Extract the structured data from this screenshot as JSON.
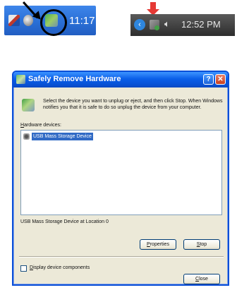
{
  "taskbar_xp": {
    "clock": "11:17"
  },
  "taskbar_win7": {
    "time": "12:52 PM",
    "volume_glyph": "🔈︎"
  },
  "dialog": {
    "title": "Safely Remove Hardware",
    "help_glyph": "?",
    "close_glyph": "✕",
    "instructions": "Select the device you want to unplug or eject, and then click Stop. When Windows notifies you that it is safe to do so unplug the device from your computer.",
    "devices_label_accel": "H",
    "devices_label_rest": "ardware devices:",
    "devices": [
      "USB Mass Storage Device"
    ],
    "status": "USB Mass Storage Device at Location 0",
    "properties_accel": "P",
    "properties_rest": "roperties",
    "stop_accel": "S",
    "stop_rest": "top",
    "display_accel": "D",
    "display_rest": "isplay device components",
    "display_checked": false,
    "close_accel": "C",
    "close_rest": "lose"
  }
}
